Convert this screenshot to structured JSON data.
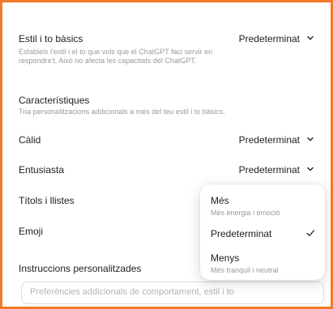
{
  "settings": {
    "base": {
      "title": "Estil i to bàsics",
      "description": "Estableix l'estil i el to que vols que el ChatGPT faci servir en respondre't. Això no afecta les capacitats del ChatGPT.",
      "value": "Predeterminat"
    },
    "characteristics": {
      "title": "Característiques",
      "description": "Tria personalitzacions addicionals a més del teu estil i to bàsics."
    },
    "warm": {
      "label": "Càlid",
      "value": "Predeterminat"
    },
    "enthusiastic": {
      "label": "Entusiasta",
      "value": "Predeterminat"
    },
    "headers_lists": {
      "label": "Títols i llistes"
    },
    "emoji": {
      "label": "Emoji"
    },
    "custom_instructions": {
      "title": "Instruccions personalitzades",
      "placeholder": "Preferències addicionals de comportament, estil i to"
    }
  },
  "dropdown": {
    "items": [
      {
        "label": "Més",
        "sublabel": "Més energia i emoció"
      },
      {
        "label": "Predeterminat",
        "selected": true
      },
      {
        "label": "Menys",
        "sublabel": "Més tranquil i neutral"
      }
    ]
  },
  "icons": {
    "chevron": "chevron-down-icon",
    "check": "check-icon"
  },
  "colors": {
    "frame": "#f07a2a"
  }
}
